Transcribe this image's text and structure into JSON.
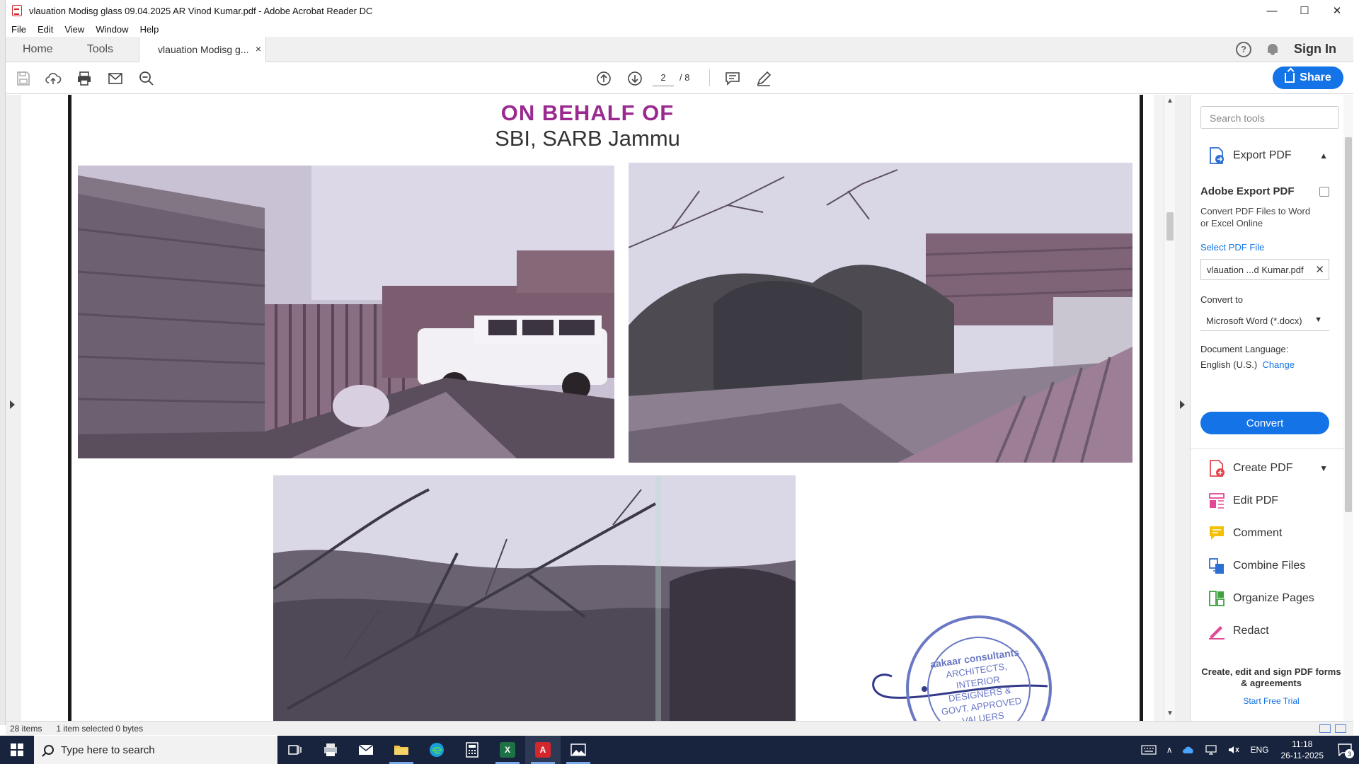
{
  "window": {
    "title": "vlauation Modisg glass 09.04.2025 AR Vinod Kumar.pdf - Adobe Acrobat Reader DC",
    "minimize": "—",
    "maximize": "☐",
    "close": "✕"
  },
  "menu": {
    "items": [
      "File",
      "Edit",
      "View",
      "Window",
      "Help"
    ]
  },
  "tabs": {
    "home": "Home",
    "tools": "Tools",
    "document": "vlauation Modisg g...",
    "close": "×",
    "help": "?",
    "signin": "Sign In"
  },
  "toolbar": {
    "page_current": "2",
    "page_total": "/ 8",
    "share": "Share"
  },
  "document": {
    "heading_line1": "ON BEHALF OF",
    "heading_line2": "SBI, SARB Jammu",
    "stamp_text": [
      "aakaar consultants",
      "ARCHITECTS,",
      "INTERIOR",
      "DESIGNERS &",
      "GOVT. APPROVED",
      "VALUERS"
    ]
  },
  "right_panel": {
    "search_placeholder": "Search tools",
    "export_pdf": "Export PDF",
    "adobe_export_title": "Adobe Export PDF",
    "adobe_export_desc": "Convert PDF Files to Word or Excel Online",
    "select_pdf_file": "Select PDF File",
    "file_name": "vlauation ...d Kumar.pdf",
    "file_clear": "✕",
    "convert_to_label": "Convert to",
    "convert_to_value": "Microsoft Word (*.docx)",
    "doc_language_label": "Document Language:",
    "doc_language_value": "English (U.S.)",
    "change_link": "Change",
    "convert_button": "Convert",
    "tools": [
      {
        "name": "create-pdf",
        "label": "Create PDF",
        "icon": "create-pdf-icon",
        "color": "#e34850"
      },
      {
        "name": "edit-pdf",
        "label": "Edit PDF",
        "icon": "edit-pdf-icon",
        "color": "#e34850"
      },
      {
        "name": "comment",
        "label": "Comment",
        "icon": "comment-icon",
        "color": "#f5c000"
      },
      {
        "name": "combine-files",
        "label": "Combine Files",
        "icon": "combine-files-icon",
        "color": "#2d6fd2"
      },
      {
        "name": "organize-pages",
        "label": "Organize Pages",
        "icon": "organize-pages-icon",
        "color": "#3ea23e"
      },
      {
        "name": "redact",
        "label": "Redact",
        "icon": "redact-icon",
        "color": "#e34893"
      }
    ],
    "promo_text": "Create, edit and sign PDF forms & agreements",
    "free_trial": "Start Free Trial"
  },
  "status_bar": {
    "item_count": "28 items",
    "selection": "1 item selected  0 bytes"
  },
  "taskbar": {
    "search_placeholder": "Type here to search",
    "apps": [
      {
        "name": "task-view",
        "icon": "task-view-icon"
      },
      {
        "name": "app-printer",
        "icon": "printer-app-icon"
      },
      {
        "name": "mail",
        "icon": "mail-icon"
      },
      {
        "name": "file-explorer",
        "icon": "folder-icon"
      },
      {
        "name": "edge",
        "icon": "edge-icon"
      },
      {
        "name": "calculator",
        "icon": "calculator-icon"
      },
      {
        "name": "excel",
        "icon": "excel-icon",
        "glyph": "X"
      },
      {
        "name": "acrobat",
        "icon": "acrobat-icon",
        "glyph": "A"
      },
      {
        "name": "photos",
        "icon": "photos-icon"
      }
    ],
    "language": "ENG",
    "time": "11:18",
    "date": "26-11-2025",
    "notification_count": "3"
  },
  "colors": {
    "accent": "#1473e6",
    "taskbar": "#18233d",
    "heading_purple": "#9a2a8f"
  }
}
